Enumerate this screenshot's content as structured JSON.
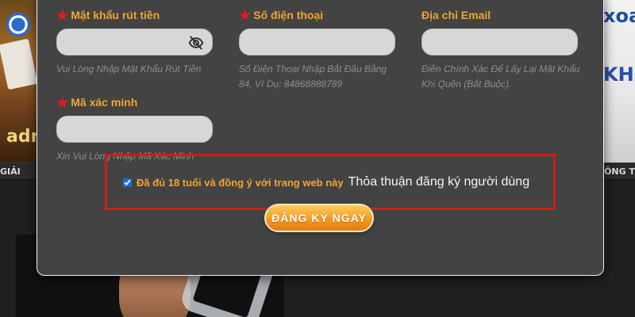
{
  "background": {
    "banner_left_text": "adr",
    "banner_right_text_1": "xoa",
    "banner_right_text_2": "KHÔ",
    "nav_left": "GIẢI",
    "nav_right": "THÔNG T"
  },
  "form": {
    "withdraw_password": {
      "label": "Mật khẩu rút tiền",
      "hint": "Vui Lòng Nhập Mật Khẩu Rút Tiền",
      "value": ""
    },
    "phone": {
      "label": "Số điện thoại",
      "hint": "Số Điện Thoại Nhập Bắt Đầu Bằng 84, Ví Dụ: 84868888789",
      "value": ""
    },
    "email": {
      "label": "Địa chỉ Email",
      "hint": "Điền Chính Xác Để Lấy Lại Mật Khẩu Khi Quên (Bắt Buộc).",
      "value": ""
    },
    "captcha": {
      "label": "Mã xác minh",
      "hint": "Xin Vui Lòng Nhập Mã Xác Minh",
      "value": ""
    },
    "agreement": {
      "checked": true,
      "text": "Đã đủ 18 tuổi và đồng ý với trang web này",
      "link": "Thỏa thuận đăng ký người dùng"
    },
    "submit_label": "ĐĂNG KÝ NGAY"
  },
  "colors": {
    "label_orange": "#f2a431",
    "required_star": "#e51b1b",
    "highlight_border": "#d01c1c",
    "modal_bg": "#434343",
    "button_orange": "#f49a1f"
  },
  "icons": {
    "password_toggle": "eye-slash-icon",
    "required": "star-icon"
  }
}
